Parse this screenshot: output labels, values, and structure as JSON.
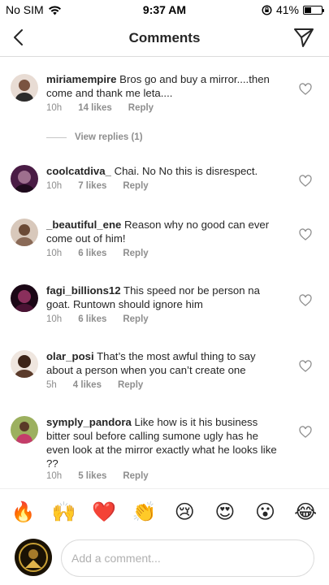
{
  "status_bar": {
    "carrier": "No SIM",
    "time": "9:37 AM",
    "battery": "41%",
    "battery_level": 0.41
  },
  "nav": {
    "title": "Comments",
    "back_icon": "chevron-left-icon",
    "send_icon": "paper-plane-icon"
  },
  "comments": [
    {
      "username": "miriamempire",
      "text": "Bros go and buy a mirror....then come and thank me leta....",
      "time": "10h",
      "likes": "14 likes",
      "reply": "Reply",
      "view_replies": "View replies (1)",
      "avatar_color": "#c9b2a6"
    },
    {
      "username": "coolcatdiva_",
      "text": "Chai. No No this is disrespect.",
      "time": "10h",
      "likes": "7 likes",
      "reply": "Reply",
      "avatar_color": "#3a1436"
    },
    {
      "username": "_beautiful_ene",
      "text": "Reason why no good can ever come out of him!",
      "time": "10h",
      "likes": "6 likes",
      "reply": "Reply",
      "avatar_color": "#8a6a57"
    },
    {
      "username": "fagi_billions12",
      "text": "This speed nor be person na goat. Runtown should ignore him",
      "time": "10h",
      "likes": "6 likes",
      "reply": "Reply",
      "avatar_color": "#2a0f22"
    },
    {
      "username": "olar_posi",
      "text": "That’s the most awful thing to say about a person when you can’t create one",
      "time": "5h",
      "likes": "4 likes",
      "reply": "Reply",
      "avatar_color": "#5b3b2b"
    },
    {
      "username": "symply_pandora",
      "text": "Like how is it his business bitter soul before calling sumone ugly has he even look at the mirror exactly what he looks like ??",
      "time": "10h",
      "likes": "5 likes",
      "reply": "Reply",
      "avatar_color": "#7a8c4a"
    }
  ],
  "emoji_bar": [
    "🔥",
    "🙌",
    "❤️",
    "👏",
    "😢",
    "😍",
    "😮",
    "😂"
  ],
  "composer": {
    "placeholder": "Add a comment...",
    "avatar_color": "#1a1205"
  },
  "colors": {
    "text": "#262626",
    "muted": "#8e8e8e",
    "divider": "#dbdbdb"
  }
}
